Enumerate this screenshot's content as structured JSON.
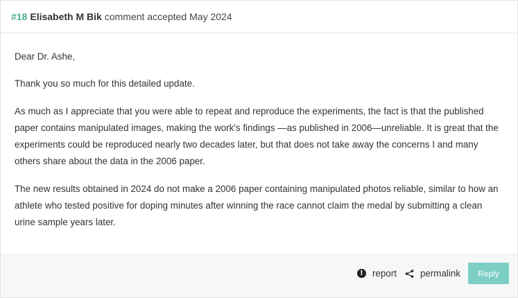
{
  "comment": {
    "number": "#18",
    "author": "Elisabeth M Bik",
    "action": "comment accepted",
    "date": "May 2024",
    "paragraphs": [
      "Dear Dr. Ashe,",
      "Thank you so much for this detailed update.",
      "As much as I appreciate that you were able to repeat and reproduce the experiments, the fact is that the published paper contains manipulated images, making the work's findings —as published in 2006—unreliable. It is great that the experiments could be reproduced nearly two decades later, but that does not take away the concerns I and many others share about the data in the 2006 paper.",
      "The new results obtained in 2024 do not make a 2006 paper containing manipulated photos reliable, similar to how an athlete who tested positive for doping minutes after winning the race cannot claim the medal by submitting a clean urine sample years later."
    ]
  },
  "footer": {
    "report_label": "report",
    "report_icon": "alert-circle-icon",
    "permalink_label": "permalink",
    "permalink_icon": "share-icon",
    "reply_label": "Reply"
  },
  "colors": {
    "accent_green": "#4caf8f",
    "reply_button": "#7dcfc5",
    "footer_bg": "#f7f7f7"
  }
}
